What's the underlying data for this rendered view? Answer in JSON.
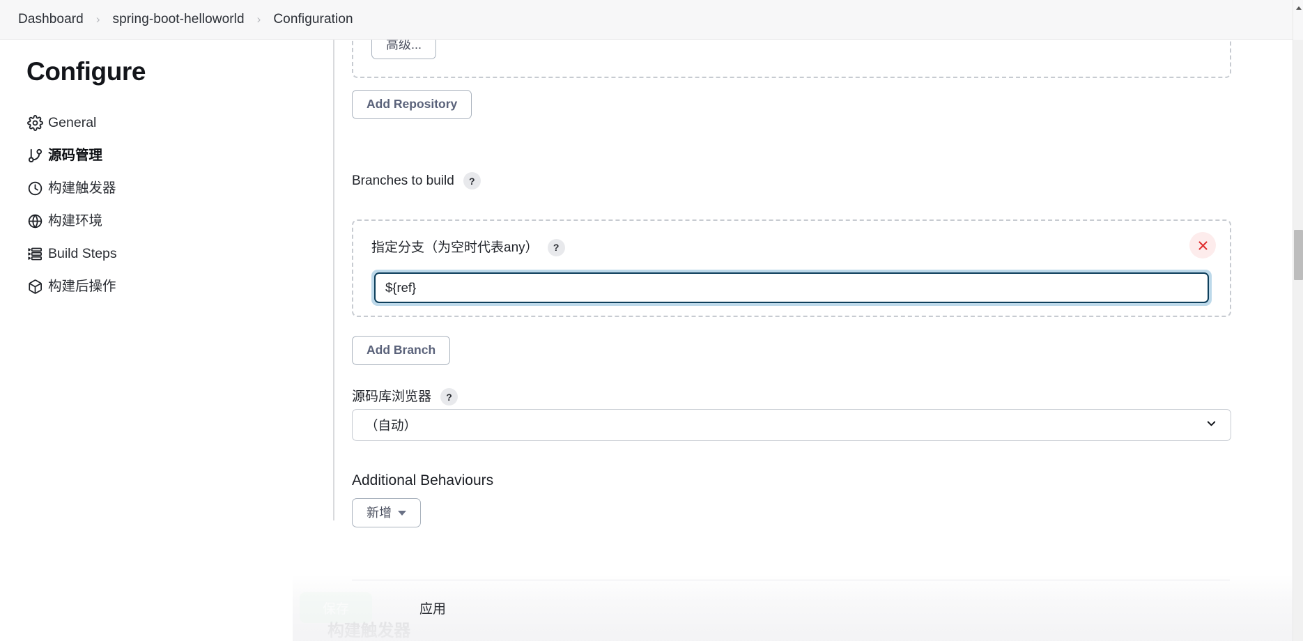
{
  "breadcrumb": {
    "items": [
      {
        "label": "Dashboard"
      },
      {
        "label": "spring-boot-helloworld"
      },
      {
        "label": "Configuration"
      }
    ],
    "separator": "›"
  },
  "sidebar": {
    "title": "Configure",
    "items": [
      {
        "label": "General",
        "icon": "gear-icon",
        "active": false
      },
      {
        "label": "源码管理",
        "icon": "git-branch-icon",
        "active": true
      },
      {
        "label": "构建触发器",
        "icon": "clock-icon",
        "active": false
      },
      {
        "label": "构建环境",
        "icon": "globe-icon",
        "active": false
      },
      {
        "label": "Build Steps",
        "icon": "list-icon",
        "active": false
      },
      {
        "label": "构建后操作",
        "icon": "package-icon",
        "active": false
      }
    ]
  },
  "scm": {
    "advanced_button": "高级...",
    "add_repository_button": "Add Repository",
    "branches_to_build_label": "Branches to build",
    "help_badge": "?",
    "branch_specifier_label": "指定分支（为空时代表any）",
    "branch_specifier_value": "${ref}",
    "branch_specifier_placeholder": "",
    "delete_branch_title": "删除",
    "add_branch_button": "Add Branch",
    "repo_browser_label": "源码库浏览器",
    "repo_browser_value": "（自动）",
    "additional_behaviours_label": "Additional Behaviours",
    "add_behaviour_button": "新增"
  },
  "next_section": {
    "heading": "构建触发器"
  },
  "action_bar": {
    "save_label": "保存",
    "apply_label": "应用"
  },
  "colors": {
    "focus_ring": "#bdd9ea",
    "input_border": "#0e3f5c",
    "danger": "#e03131",
    "button_text": "#5a627a"
  }
}
